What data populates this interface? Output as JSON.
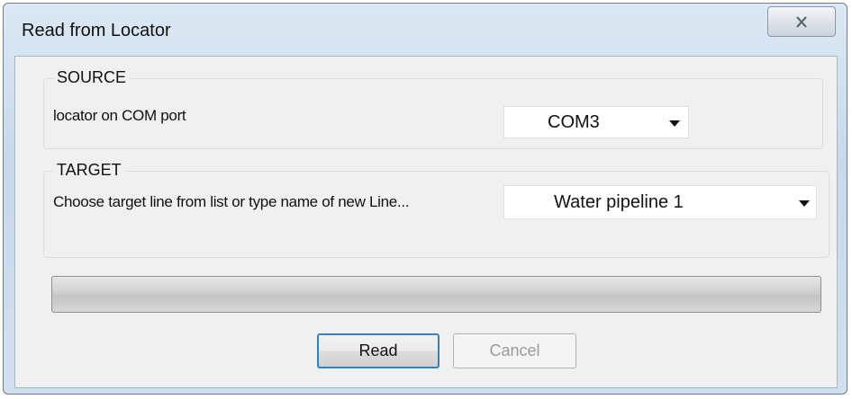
{
  "window": {
    "title": "Read from Locator",
    "close_icon": "close-x-icon"
  },
  "source": {
    "legend": "SOURCE",
    "port_label": "locator on COM port",
    "port_value": "COM3"
  },
  "target": {
    "legend": "TARGET",
    "line_label": "Choose target line from list or type name of new Line...",
    "line_value": "Water pipeline 1"
  },
  "progress": {
    "value_percent": 0
  },
  "buttons": {
    "read_label": "Read",
    "cancel_label": "Cancel",
    "cancel_enabled": false
  },
  "colors": {
    "accent_border": "#3c7fb1",
    "progress_fill": "#37b24d"
  }
}
